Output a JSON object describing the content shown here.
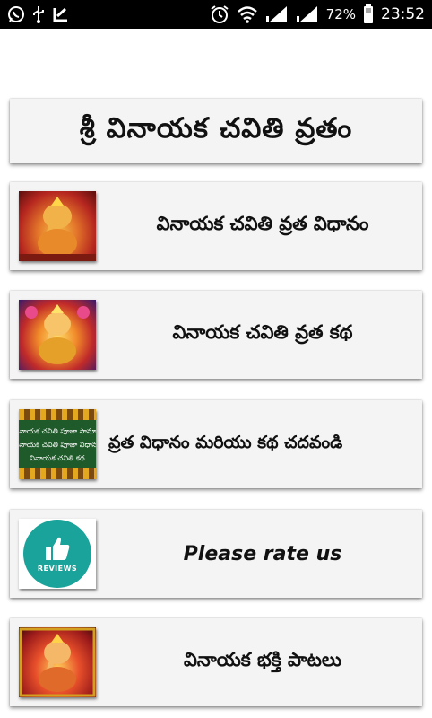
{
  "status_bar": {
    "battery_percent": "72%",
    "time": "23:52",
    "icons_left": [
      "whatsapp-icon",
      "usb-icon",
      "download-icon"
    ],
    "icons_right": [
      "alarm-icon",
      "wifi-icon",
      "signal-icon",
      "signal-icon",
      "battery-icon"
    ]
  },
  "title": "శ్రీ వినాయక చవితి వ్రతం",
  "menu": [
    {
      "label": "వినాయక చవితి వ్రత విధానం",
      "icon": "ganesha-image"
    },
    {
      "label": "వినాయక చవితి వ్రత కథ",
      "icon": "ganesha-image"
    },
    {
      "label": "వ్రత విధానం మరియు కథ చదవండి",
      "icon": "text-banner-image",
      "thumb_lines": [
        "వినాయక చవితి పూజా సామాగ్రి",
        "వినాయక చవితి పూజా విధానం",
        "వినాయక చవితి కథ"
      ]
    },
    {
      "label": "Please rate us",
      "icon": "reviews-icon",
      "thumb_text": "REVIEWS"
    },
    {
      "label": "వినాయక భక్తి పాటలు",
      "icon": "ganesha-image"
    }
  ],
  "colors": {
    "card_bg": "#f4f4f4",
    "status_bar_bg": "#000000",
    "reviews_teal": "#1aa39a"
  }
}
